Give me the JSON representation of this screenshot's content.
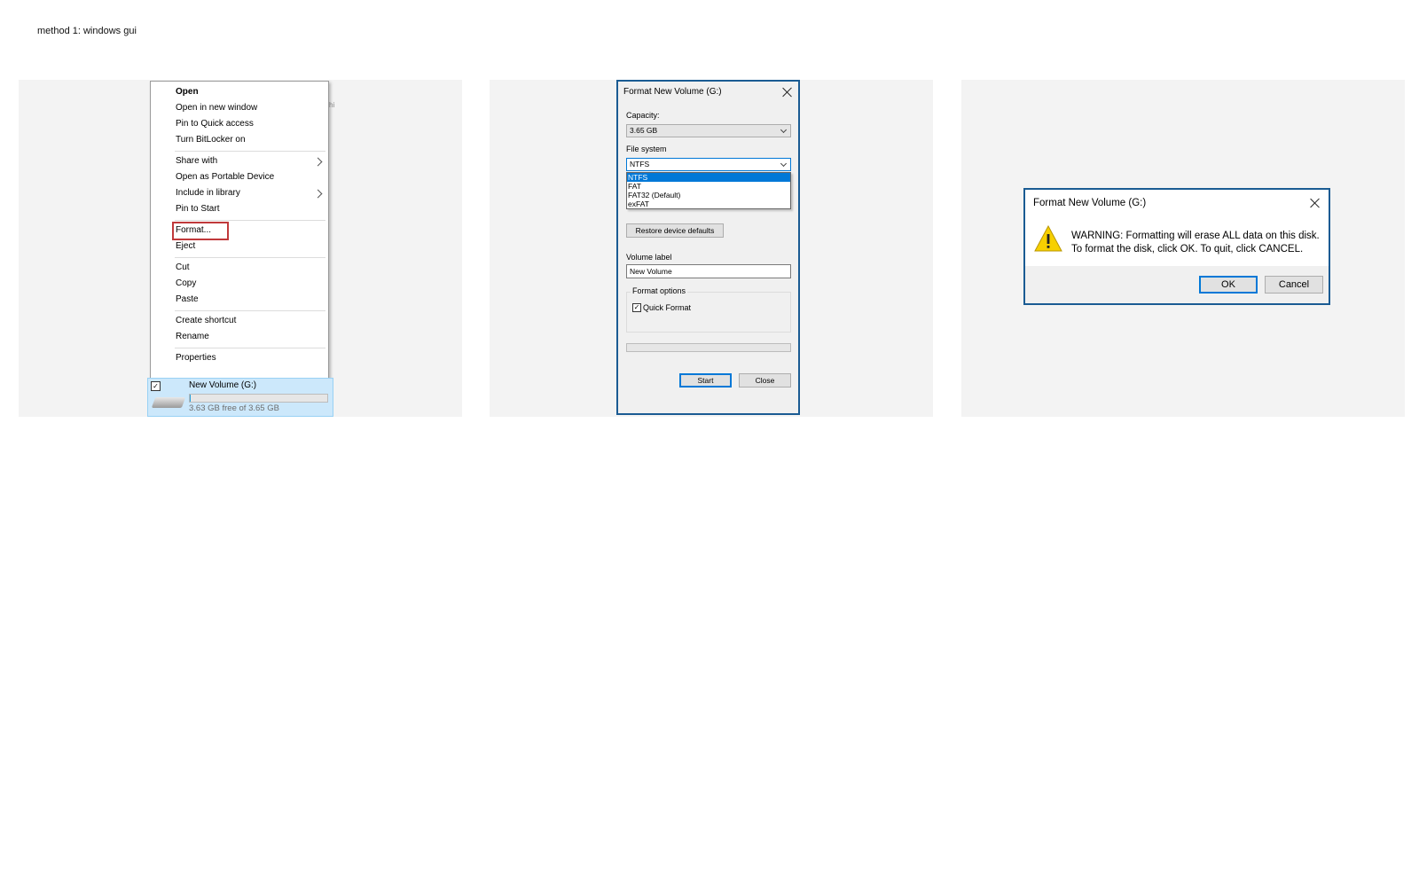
{
  "heading": "method 1: windows gui",
  "context_menu": {
    "items": [
      {
        "label": "Open"
      },
      {
        "label": "Open in new window"
      },
      {
        "label": "Pin to Quick access"
      },
      {
        "label": "Turn BitLocker on"
      },
      {
        "label": "Share with"
      },
      {
        "label": "Open as Portable Device"
      },
      {
        "label": "Include in library"
      },
      {
        "label": "Pin to Start"
      },
      {
        "label": "Format..."
      },
      {
        "label": "Eject"
      },
      {
        "label": "Cut"
      },
      {
        "label": "Copy"
      },
      {
        "label": "Paste"
      },
      {
        "label": "Create shortcut"
      },
      {
        "label": "Rename"
      },
      {
        "label": "Properties"
      }
    ],
    "behind_fragment": "hi"
  },
  "drive": {
    "name": "New Volume (G:)",
    "free_text": "3.63 GB free of 3.65 GB",
    "used_fraction": 0.005,
    "checked": "✓"
  },
  "format_dialog": {
    "title": "Format New Volume (G:)",
    "capacity_label": "Capacity:",
    "capacity_value": "3.65 GB",
    "filesystem_label": "File system",
    "filesystem_value": "NTFS",
    "filesystem_options": [
      "NTFS",
      "FAT",
      "FAT32 (Default)",
      "exFAT"
    ],
    "restore_button": "Restore device defaults",
    "volume_label": "Volume label",
    "volume_value": "New Volume",
    "format_options_label": "Format options",
    "quick_format_label": "Quick Format",
    "quick_format_check": "✓",
    "start_button": "Start",
    "close_button": "Close"
  },
  "warning_dialog": {
    "title": "Format New Volume (G:)",
    "message_line1": "WARNING: Formatting will erase ALL data on this disk.",
    "message_line2": "To format the disk, click OK. To quit, click CANCEL.",
    "ok_button": "OK",
    "cancel_button": "Cancel"
  },
  "colors": {
    "selection": "#0078d7",
    "dialog_border": "#1a5b93",
    "highlight_box": "#c0393b",
    "drive_selection": "#cce8fb",
    "warning_yellow": "#f7d000"
  }
}
